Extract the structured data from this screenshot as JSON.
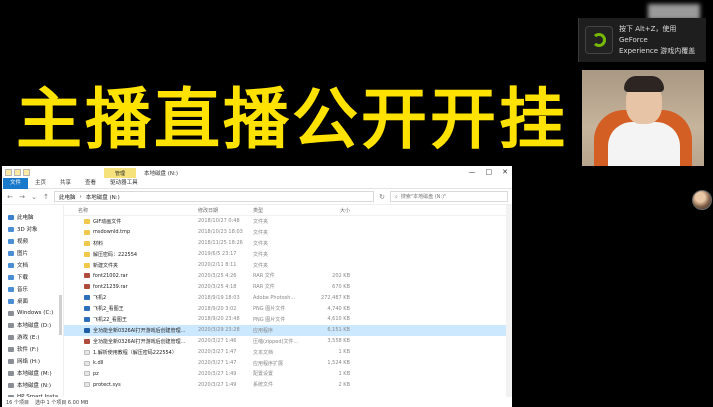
{
  "headline": "主播直播公开开挂",
  "notification": {
    "line1": "按下 Alt+Z，使用 GeForce",
    "line2": "Experience 游戏内覆盖"
  },
  "explorer": {
    "manage_tab": "管理",
    "window_title": "本地磁盘 (N:)",
    "window_controls": [
      "—",
      "□",
      "✕"
    ],
    "ribbon_tabs": [
      "文件",
      "主页",
      "共享",
      "查看",
      "驱动器工具"
    ],
    "address": [
      "此电脑",
      "本地磁盘 (N:)"
    ],
    "search_placeholder": "搜索\"本地磁盘 (N:)\"",
    "nav": [
      {
        "label": "此电脑",
        "kind": "top"
      },
      {
        "label": "3D 对象",
        "kind": "folder"
      },
      {
        "label": "视频",
        "kind": "folder"
      },
      {
        "label": "图片",
        "kind": "folder"
      },
      {
        "label": "文档",
        "kind": "folder"
      },
      {
        "label": "下载",
        "kind": "folder"
      },
      {
        "label": "音乐",
        "kind": "folder"
      },
      {
        "label": "桌面",
        "kind": "folder"
      },
      {
        "label": "Windows (C:)",
        "kind": "drive"
      },
      {
        "label": "本地磁盘 (D:)",
        "kind": "drive"
      },
      {
        "label": "游戏 (E:)",
        "kind": "drive"
      },
      {
        "label": "软件 (F:)",
        "kind": "drive"
      },
      {
        "label": "网络 (H:)",
        "kind": "drive"
      },
      {
        "label": "本地磁盘 (M:)",
        "kind": "drive"
      },
      {
        "label": "本地磁盘 (N:)",
        "kind": "drive"
      },
      {
        "label": "HP Smart Insta",
        "kind": "drive"
      }
    ],
    "columns": {
      "name": "名称",
      "date": "修改日期",
      "type": "类型",
      "size": "大小"
    },
    "files": [
      {
        "name": "GIF动画文件",
        "date": "2018/10/27 0:48",
        "type": "文件夹",
        "size": "",
        "icon": "folder"
      },
      {
        "name": "msdownld.tmp",
        "date": "2018/10/23 18:03",
        "type": "文件夹",
        "size": "",
        "icon": "folder"
      },
      {
        "name": "材料",
        "date": "2018/11/25 18:26",
        "type": "文件夹",
        "size": "",
        "icon": "folder"
      },
      {
        "name": "解压密码：222554",
        "date": "2019/6/5 23:17",
        "type": "文件夹",
        "size": "",
        "icon": "folder"
      },
      {
        "name": "新建文件夹",
        "date": "2020/2/11 8:11",
        "type": "文件夹",
        "size": "",
        "icon": "folder"
      },
      {
        "name": "font21002.rar",
        "date": "2020/3/25 4:26",
        "type": "RAR 文件",
        "size": "202 KB",
        "icon": "zip"
      },
      {
        "name": "font21239.rar",
        "date": "2020/3/25 4:18",
        "type": "RAR 文件",
        "size": "670 KB",
        "icon": "zip"
      },
      {
        "name": "飞机2",
        "date": "2018/9/19 18:03",
        "type": "Adobe Photosh...",
        "size": "272,487 KB",
        "icon": "img"
      },
      {
        "name": "飞机2_看图王",
        "date": "2018/9/20 3:02",
        "type": "PNG 图片文件",
        "size": "4,740 KB",
        "icon": "img"
      },
      {
        "name": "飞机22_看图王",
        "date": "2018/9/20 23:48",
        "type": "PNG 图片文件",
        "size": "4,610 KB",
        "icon": "img"
      },
      {
        "name": "全功能全新0326AI打开游戏后创建管理...",
        "date": "2020/3/29 23:28",
        "type": "应用程序",
        "size": "6,151 KB",
        "icon": "app",
        "selected": true
      },
      {
        "name": "全功能全新0326AI打开游戏后创建管理...",
        "date": "2020/3/27 1:46",
        "type": "压缩(zipped)文件...",
        "size": "3,558 KB",
        "icon": "zip"
      },
      {
        "name": "1.解析使用教程（解压密码222554）",
        "date": "2020/3/27 1:47",
        "type": "文本文档",
        "size": "1 KB",
        "icon": "file"
      },
      {
        "name": "k.dll",
        "date": "2020/3/27 1:47",
        "type": "应用程序扩展",
        "size": "1,524 KB",
        "icon": "file"
      },
      {
        "name": "pz",
        "date": "2020/3/27 1:49",
        "type": "配置设置",
        "size": "1 KB",
        "icon": "file"
      },
      {
        "name": "protect.sys",
        "date": "2020/3/27 1:49",
        "type": "系统文件",
        "size": "2 KB",
        "icon": "file"
      }
    ],
    "status": {
      "count": "16 个项目",
      "selected": "选中 1 个项目  6.00 MB"
    }
  }
}
